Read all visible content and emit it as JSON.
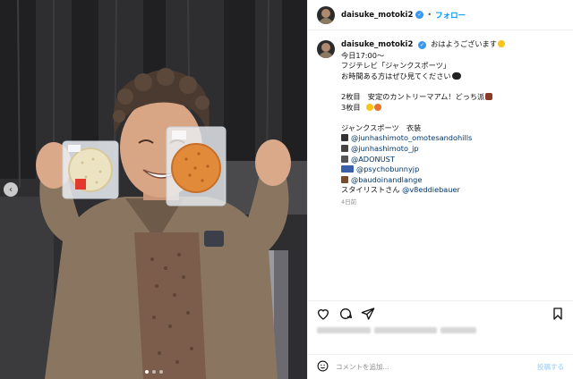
{
  "post": {
    "username": "daisuke_motoki2",
    "follow_label": "フォロー",
    "separator": "•",
    "caption": {
      "username": "daisuke_motoki2",
      "first_line": "おはようございます",
      "lines": [
        "今日17:00〜",
        "フジテレビ「ジャンクスポーツ」",
        "お時間ある方はぜひ見てください"
      ],
      "lines2": [
        "2枚目　安定のカントリーマアム！どっち派",
        "3枚目"
      ],
      "costume_heading": "ジャンクスポーツ　衣装",
      "credits": [
        "@junhashimoto_omotesandohills",
        "@junhashimoto_jp",
        "@ADONUST",
        "@psychobunnyjp",
        "@baudoinandlange"
      ],
      "stylist_prefix": "スタイリストさん",
      "stylist_handle": "@v8eddiebauer"
    },
    "time_ago": "4日前",
    "comment_placeholder": "コメントを追加...",
    "post_button": "投稿する"
  },
  "icons": {
    "emoji_sun": "sun-emoji",
    "emoji_eyes": "eyes-emoji",
    "emoji_shoes": "shoes-emoji",
    "emoji_faces": "faces-emoji",
    "like": "heart-icon",
    "comment": "comment-icon",
    "share": "share-icon",
    "save": "bookmark-icon",
    "emoji_picker": "smile-icon"
  },
  "colors": {
    "accent": "#0095f6",
    "link": "#00376b",
    "verified": "#3897f0"
  }
}
